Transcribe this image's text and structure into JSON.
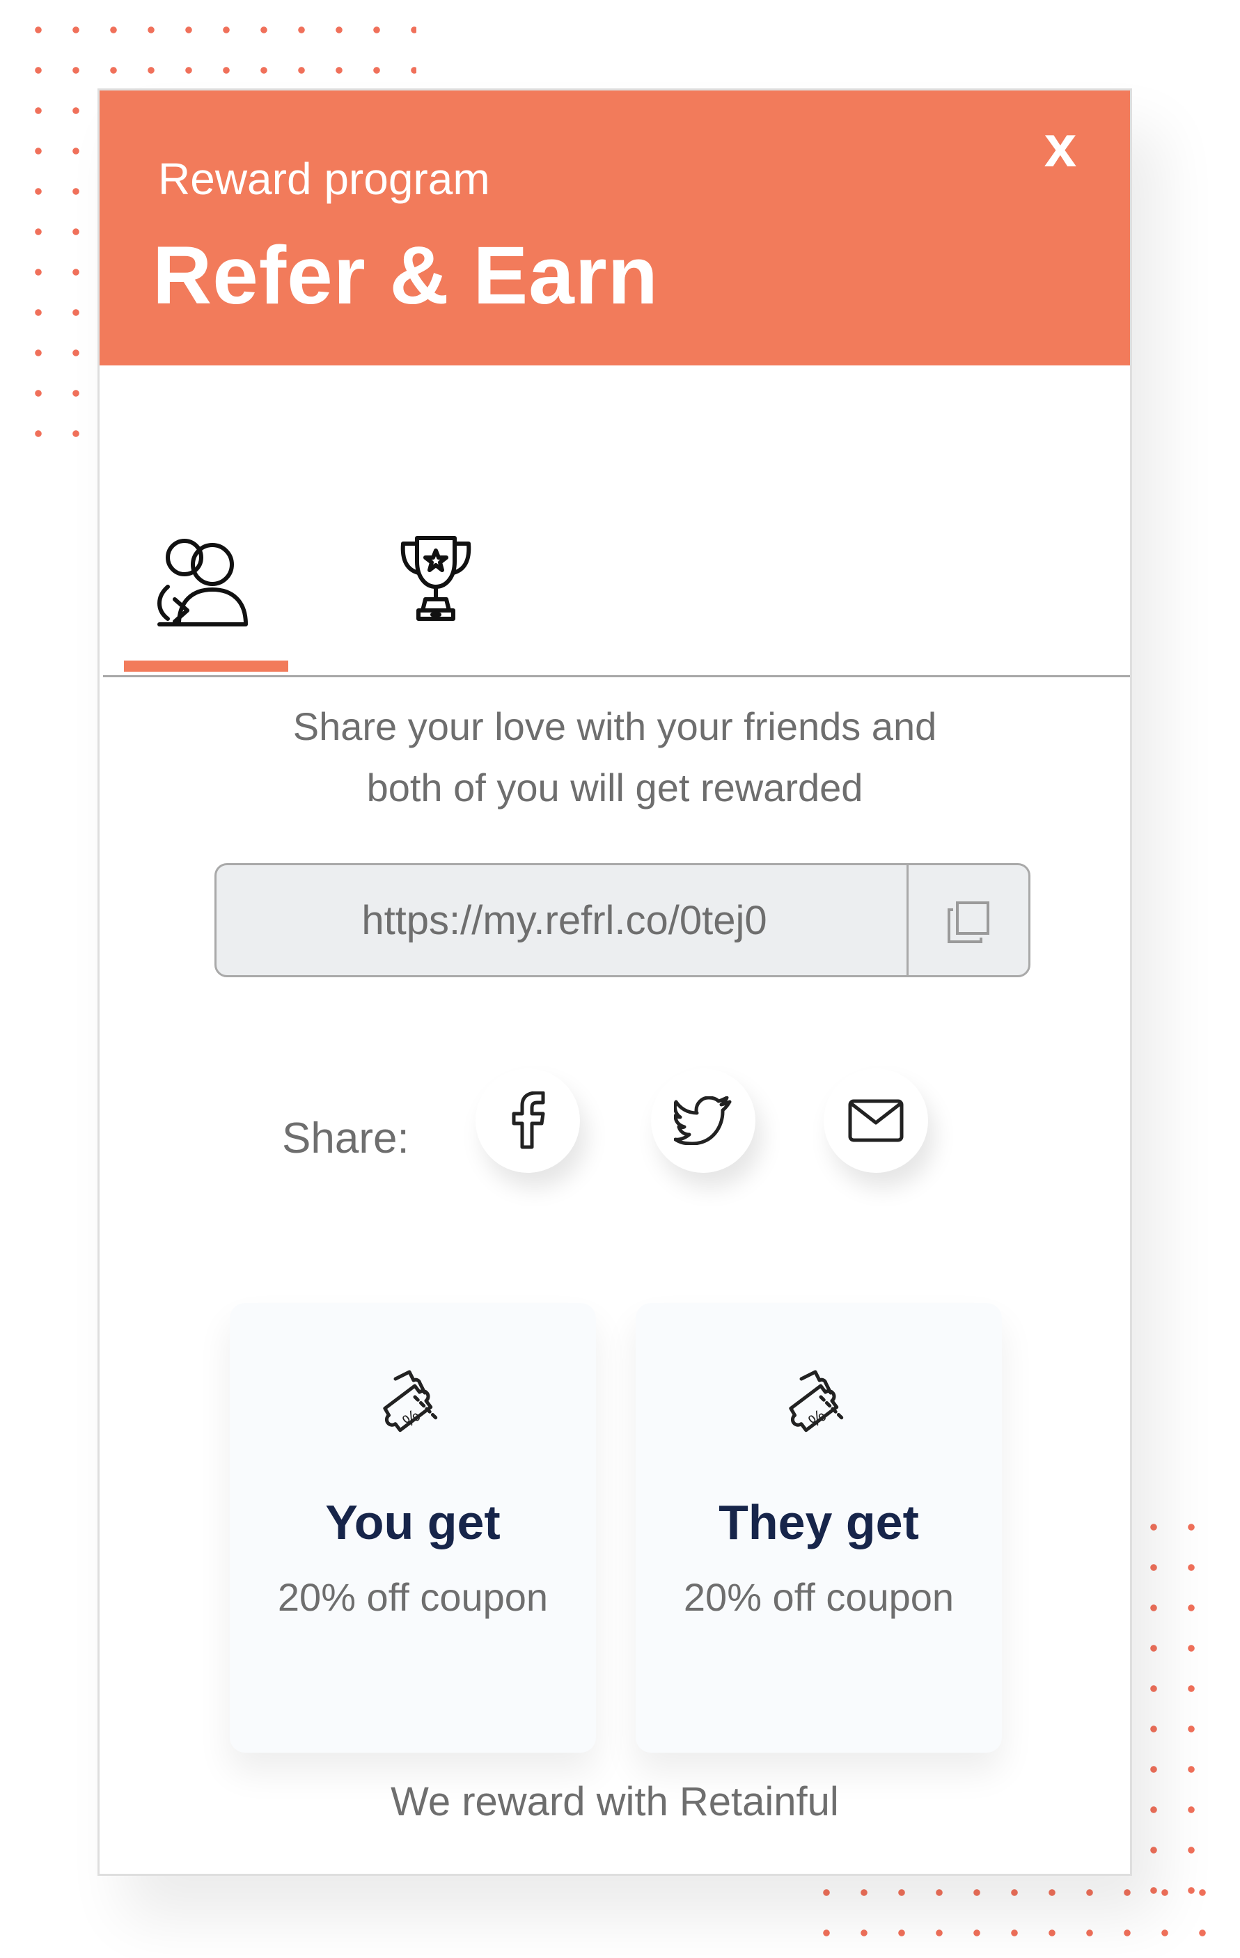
{
  "colors": {
    "accent": "#f27b5b",
    "dots": "#f0705a",
    "title_dark": "#17254a",
    "text_gray": "#6e6e6e",
    "link_bg": "#eceef0"
  },
  "header": {
    "subtitle": "Reward program",
    "title": "Refer & Earn",
    "close_label": "x"
  },
  "tabs": [
    {
      "name": "referral",
      "icon": "users-refer-icon",
      "active": true
    },
    {
      "name": "rewards",
      "icon": "trophy-icon",
      "active": false
    }
  ],
  "description": "Share your love with your friends and both of you will get rewarded",
  "link": {
    "url": "https://my.refrl.co/0tej0",
    "copy_icon": "copy-icon"
  },
  "share": {
    "label": "Share:",
    "buttons": [
      {
        "name": "facebook",
        "icon": "facebook-icon"
      },
      {
        "name": "twitter",
        "icon": "twitter-icon"
      },
      {
        "name": "email",
        "icon": "mail-icon"
      }
    ]
  },
  "rewards": {
    "you": {
      "title": "You get",
      "value": "20% off coupon",
      "icon": "coupon-ticket-icon"
    },
    "they": {
      "title": "They get",
      "value": "20% off coupon",
      "icon": "coupon-ticket-icon"
    }
  },
  "footer": {
    "text": "We reward with Retainful"
  }
}
